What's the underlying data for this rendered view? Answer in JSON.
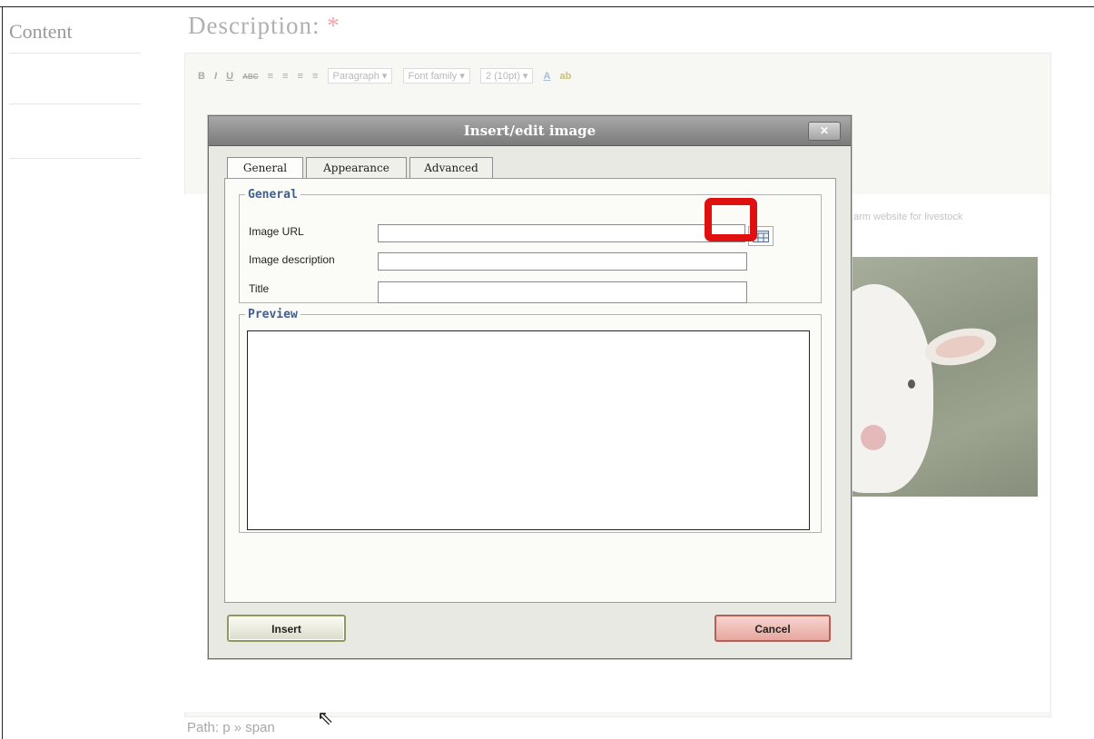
{
  "sidebar": {
    "title": "Content"
  },
  "description": {
    "label": "Description:",
    "required_marker": "*"
  },
  "toolbar": {
    "row1_buttons": [
      "B",
      "I",
      "U",
      "ABC",
      "≡",
      "≡",
      "≡",
      "≡"
    ],
    "format_select": "Paragraph",
    "font_family_select": "Font family",
    "font_size_select": "2 (10pt)",
    "text_color_icon": "A",
    "highlight_icon": "ab"
  },
  "background": {
    "fragment_text": "arm website for livestock",
    "image_alt": "lamb photo"
  },
  "statusbar": {
    "path": "Path: p » span"
  },
  "dialog": {
    "title": "Insert/edit image",
    "close_label": "✕",
    "tabs": [
      {
        "label": "General",
        "active": true
      },
      {
        "label": "Appearance",
        "active": false
      },
      {
        "label": "Advanced",
        "active": false
      }
    ],
    "general_section": {
      "legend": "General",
      "image_url_label": "Image URL",
      "image_url_value": "",
      "image_description_label": "Image description",
      "image_description_value": "",
      "title_label": "Title",
      "title_value": "",
      "browse_icon": "browse-icon"
    },
    "preview_section": {
      "legend": "Preview"
    },
    "insert_label": "Insert",
    "cancel_label": "Cancel"
  },
  "colors": {
    "highlight_frame": "#e11010",
    "legend_text": "#3f5f8f",
    "titlebar": "#8a8a8a"
  }
}
